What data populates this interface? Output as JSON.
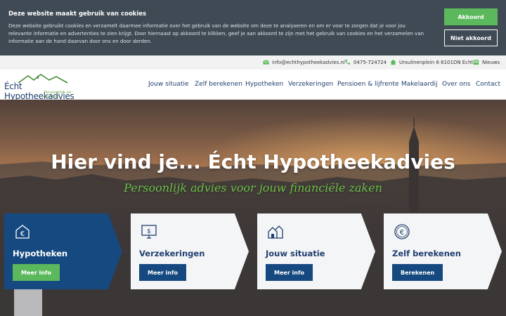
{
  "cookie": {
    "title": "Deze website maakt gebruik van cookies",
    "text": "Deze website gebruikt cookies en verzamelt daarmee informatie over het gebruik van de website om deze te analyseren en om er voor te zorgen dat je voor jou relevante informatie en advertenties te zien krijgt. Door hiernaast op akkoord te klikken, geef je aan akkoord te zijn met het gebruik van cookies en het verzamelen van informatie aan de hand daarvan door ons en door derden.",
    "accept_label": "Akkoord",
    "reject_label": "Niet akkoord"
  },
  "topbar": {
    "email": "info@echthypotheekadvies.nl",
    "phone": "0475-724724",
    "address": "Ursulinenplein 6 6101DN Echt",
    "news": "Nieuws"
  },
  "logo": {
    "name": "Écht Hypotheekadvies",
    "tagline": "Persoonlijk en dichtbij"
  },
  "nav": [
    "Jouw situatie",
    "Zelf berekenen",
    "Hypotheken",
    "Verzekeringen",
    "Pensioen & lijfrente",
    "Makelaardij",
    "Over ons",
    "Contact"
  ],
  "hero": {
    "title": "Hier vind je... Écht Hypotheekadvies",
    "subtitle": "Persoonlijk advies voor jouw financiële zaken"
  },
  "cards": [
    {
      "title": "Hypotheken",
      "button": "Meer info",
      "icon": "euro-house-icon"
    },
    {
      "title": "Verzekeringen",
      "button": "Meer info",
      "icon": "monitor-dollar-icon"
    },
    {
      "title": "Jouw situatie",
      "button": "Meer info",
      "icon": "houses-icon"
    },
    {
      "title": "Zelf berekenen",
      "button": "Berekenen",
      "icon": "euro-coin-icon"
    }
  ],
  "colors": {
    "navy": "#15497f",
    "green": "#5cb85c",
    "cookie_bg": "#3f4a55"
  }
}
